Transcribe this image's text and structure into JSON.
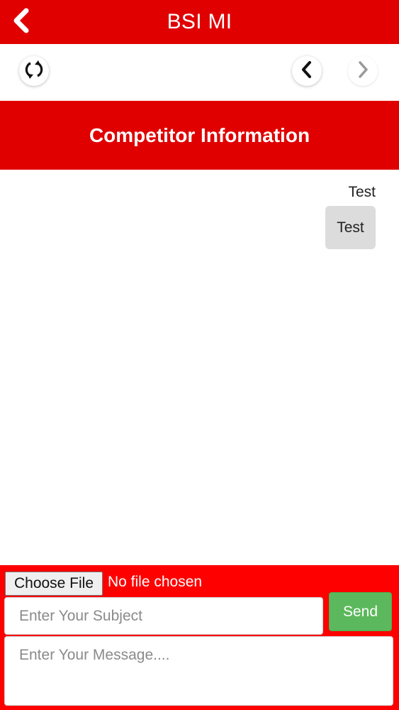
{
  "app_bar": {
    "title": "BSI MI",
    "back_icon": "chevron-left-icon"
  },
  "toolbar": {
    "refresh_icon": "refresh-icon",
    "prev_icon": "chevron-left-icon",
    "next_icon": "chevron-right-icon",
    "next_enabled": false
  },
  "section": {
    "title": "Competitor Information"
  },
  "thread": {
    "messages": [
      {
        "subject": "Test",
        "body": "Test"
      }
    ]
  },
  "compose": {
    "file_button_label": "Choose File",
    "file_status": "No file chosen",
    "subject_placeholder": "Enter Your Subject",
    "message_placeholder": "Enter Your Message....",
    "send_label": "Send"
  },
  "colors": {
    "brand_red": "#e00000",
    "compose_red": "#fe0000",
    "send_green": "#5cb85c",
    "bubble_gray": "#dcdcdc"
  }
}
